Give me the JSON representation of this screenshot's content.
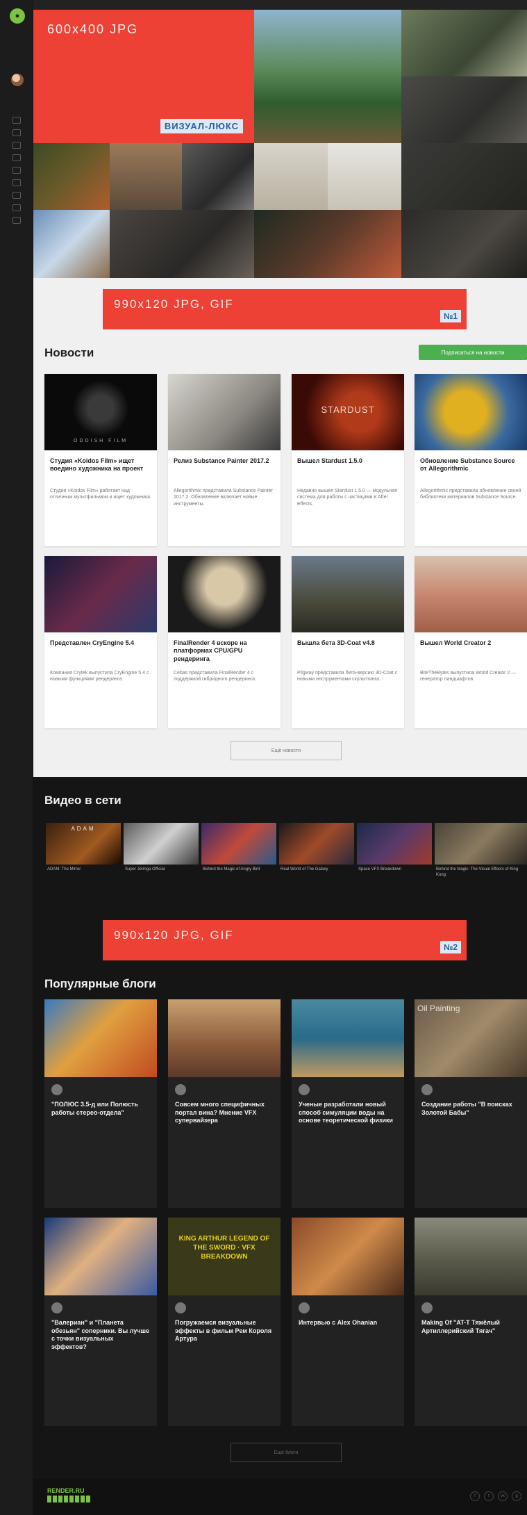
{
  "hero": {
    "ad_size_label": "600x400 JPG",
    "ad_brand_label": "ВИЗУАЛ-ЛЮКС"
  },
  "banners": [
    {
      "size_label": "990x120 JPG, GIF",
      "number_label": "№1"
    },
    {
      "size_label": "990x120 JPG, GIF",
      "number_label": "№2"
    }
  ],
  "news": {
    "title": "Новости",
    "subscribe_label": "Подписаться на новости",
    "more_label": "Ещё новости",
    "thumb_titles": [
      "ODDISH FILM",
      "",
      "STARDUST",
      "",
      "",
      "",
      "",
      ""
    ],
    "cards": [
      {
        "title": "Студия «Koidos Film» ищет воедино художника на проект",
        "excerpt": "Студия «Koidos Film» работает над отличным мультфильмом и ищет художника.",
        "date": "",
        "views": "",
        "comments": ""
      },
      {
        "title": "Релиз Substance Painter 2017.2",
        "excerpt": "Allegorithmic представила Substance Painter 2017.2. Обновление включает новые инструменты.",
        "date": "",
        "views": "",
        "comments": ""
      },
      {
        "title": "Вышел Stardust 1.5.0",
        "excerpt": "Недавно вышел Stardust 1.5.0 — модульная система для работы с частицами в After Effects.",
        "date": "",
        "views": "",
        "comments": ""
      },
      {
        "title": "Обновление Substance Source от Allegorithmic",
        "excerpt": "Allegorithmic представила обновление своей библиотеки материалов Substance Source.",
        "date": "",
        "views": "",
        "comments": ""
      },
      {
        "title": "Представлен CryEngine 5.4",
        "excerpt": "Компания Crytek выпустила CryEngine 5.4 с новыми функциями рендеринга.",
        "date": "",
        "views": "",
        "comments": ""
      },
      {
        "title": "FinalRender 4 вскоре на платформах CPU/GPU рендеринга",
        "excerpt": "Cebas представила FinalRender 4 с поддержкой гибридного рендеринга.",
        "date": "",
        "views": "",
        "comments": ""
      },
      {
        "title": "Вышла бета 3D-Coat v4.8",
        "excerpt": "Pilgway представила бета-версию 3D-Coat с новыми инструментами скульптинга.",
        "date": "",
        "views": "",
        "comments": ""
      },
      {
        "title": "Вышел World Creator 2",
        "excerpt": "BiteTheBytes выпустила World Creator 2 — генератор ландшафтов.",
        "date": "",
        "views": "",
        "comments": ""
      }
    ]
  },
  "videos": {
    "title": "Видео в сети",
    "thumb_titles": [
      "ADAM",
      "",
      "",
      "",
      "",
      ""
    ],
    "cards": [
      {
        "title": "ADAM: The Mirror",
        "date": "",
        "views": ""
      },
      {
        "title": "Super Jeringa Official",
        "date": "",
        "views": ""
      },
      {
        "title": "Behind the Magic of Angry Bird",
        "date": "",
        "views": ""
      },
      {
        "title": "Real World of The Galaxy",
        "date": "",
        "views": ""
      },
      {
        "title": "Space VFX Breakdown",
        "date": "",
        "views": ""
      },
      {
        "title": "Behind the Magic: The Visual Effects of King Kong",
        "date": "",
        "views": ""
      }
    ]
  },
  "blogs": {
    "title": "Популярные блоги",
    "more_label": "Ещё блоги",
    "thumb_titles": [
      "",
      "",
      "",
      "Oil Painting",
      "",
      "KING ARTHUR LEGEND OF THE SWORD · VFX BREAKDOWN",
      "",
      ""
    ],
    "cards": [
      {
        "author": "",
        "title": "\"ПОЛЮС 3.5-д или Полюсть работы стерео-отдела\"",
        "sub": "",
        "excerpt": "",
        "date": "",
        "views": "",
        "comments": ""
      },
      {
        "author": "",
        "title": "Совсем много специфичных портал вина? Мнение VFX супервайзера",
        "sub": "",
        "excerpt": "",
        "date": "",
        "views": "",
        "comments": ""
      },
      {
        "author": "",
        "title": "Ученые разработали новый способ симуляции воды на основе теоретической физики",
        "sub": "",
        "excerpt": "",
        "date": "",
        "views": "",
        "comments": ""
      },
      {
        "author": "",
        "title": "Создание работы \"В поисках Золотой Бабы\"",
        "sub": "",
        "excerpt": "",
        "date": "",
        "views": "",
        "comments": ""
      },
      {
        "author": "",
        "title": "\"Валериан\" и \"Планета обезьян\" соперники. Вы лучше с точки визуальных эффектов?",
        "sub": "",
        "excerpt": "",
        "date": "",
        "views": "",
        "comments": ""
      },
      {
        "author": "",
        "title": "Погружаемся визуальные эффекты в фильм Рем Короля Артура",
        "sub": "",
        "excerpt": "",
        "date": "",
        "views": "",
        "comments": ""
      },
      {
        "author": "",
        "title": "Интервью с Alex Ohanian",
        "sub": "",
        "excerpt": "",
        "date": "",
        "views": "",
        "comments": ""
      },
      {
        "author": "",
        "title": "Making Of \"AT-T Тяжёлый Артиллерийский Тягач\"",
        "sub": "",
        "excerpt": "",
        "date": "",
        "views": "",
        "comments": ""
      }
    ]
  },
  "footer": {
    "logo_text": "RENDER.RU",
    "copyright": "",
    "social_icons": [
      "f",
      "t",
      "vk",
      "g"
    ]
  },
  "colors": {
    "ad_red": "#ee4136",
    "brand_green": "#7cc243",
    "subscribe_green": "#4caf50"
  }
}
